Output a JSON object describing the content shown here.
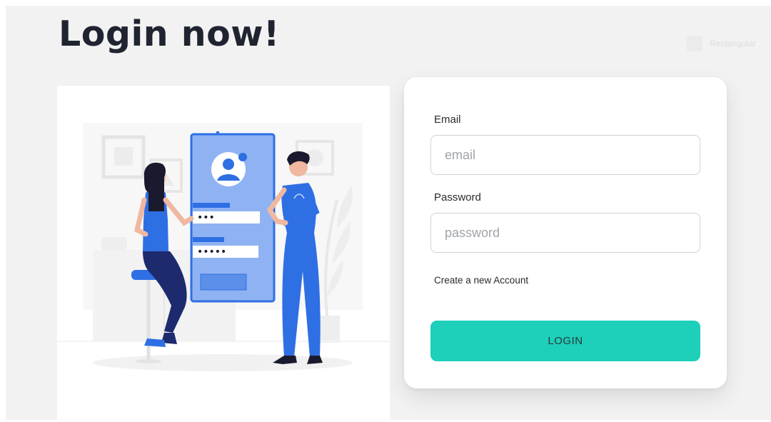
{
  "page": {
    "title": "Login now!",
    "ghost_badge_text": "Rectangular"
  },
  "form": {
    "email_label": "Email",
    "email_placeholder": "email",
    "email_value": "",
    "password_label": "Password",
    "password_placeholder": "password",
    "password_value": "",
    "create_account_link": "Create a new Account",
    "login_button": "LOGIN"
  },
  "illustration": {
    "password_dots_1": "•••",
    "password_dots_2": "•••••"
  },
  "colors": {
    "accent": "#1ecfba",
    "illustration_blue": "#2f6fe4",
    "phone_blue": "#8fb3f2",
    "title": "#1f2430",
    "background": "#f2f2f2"
  },
  "icons": [
    "user-avatar-icon"
  ]
}
